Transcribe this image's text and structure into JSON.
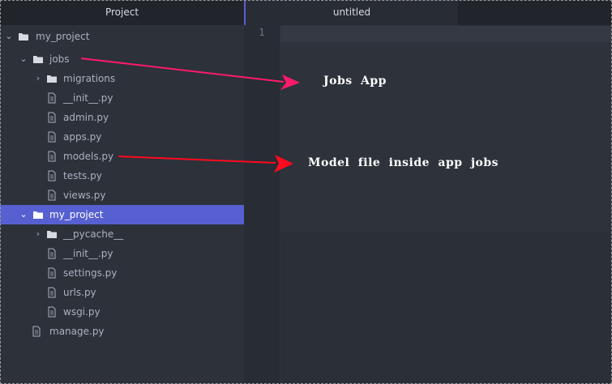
{
  "sidebar": {
    "title": "Project",
    "tree": [
      {
        "label": "my_project",
        "kind": "root"
      },
      {
        "label": "jobs",
        "kind": "folder-open"
      },
      {
        "label": "migrations",
        "kind": "folder-closed"
      },
      {
        "label": "__init__.py",
        "kind": "file"
      },
      {
        "label": "admin.py",
        "kind": "file"
      },
      {
        "label": "apps.py",
        "kind": "file"
      },
      {
        "label": "models.py",
        "kind": "file"
      },
      {
        "label": "tests.py",
        "kind": "file"
      },
      {
        "label": "views.py",
        "kind": "file"
      },
      {
        "label": "my_project",
        "kind": "folder-open",
        "selected": true
      },
      {
        "label": "__pycache__",
        "kind": "folder-closed"
      },
      {
        "label": "__init__.py",
        "kind": "file"
      },
      {
        "label": "settings.py",
        "kind": "file"
      },
      {
        "label": "urls.py",
        "kind": "file"
      },
      {
        "label": "wsgi.py",
        "kind": "file"
      },
      {
        "label": "manage.py",
        "kind": "file"
      }
    ]
  },
  "editor": {
    "tab_title": "untitled",
    "line_number": "1"
  },
  "annotations": {
    "jobs_app": "Jobs App",
    "model_file": "Model file inside app jobs"
  },
  "colors": {
    "selection": "#5760d1",
    "arrow_pink": "#ff1a6a",
    "arrow_red": "#ff0a1e"
  }
}
